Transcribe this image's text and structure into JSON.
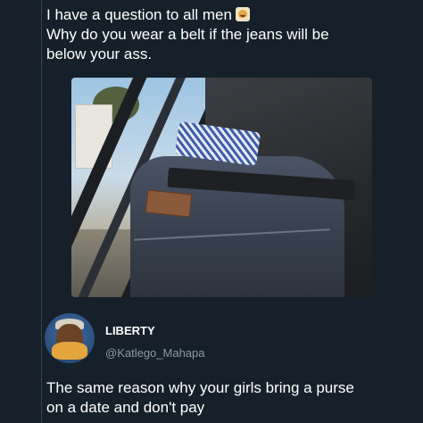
{
  "post": {
    "lines": [
      "I have a question to all men",
      "Why do you wear a belt if the jeans will be",
      "below your ass."
    ],
    "emoji_icon": "face-with-hand-emoji"
  },
  "reply": {
    "author_name": "LIBERTY",
    "author_handle": "@Katlego_Mahapa",
    "lines": [
      "The same reason why your girls bring a purse",
      "on a date and don't pay"
    ]
  },
  "colors": {
    "background": "#15202b",
    "text": "#ffffff",
    "handle": "#8899a6",
    "divider": "#38444d"
  }
}
